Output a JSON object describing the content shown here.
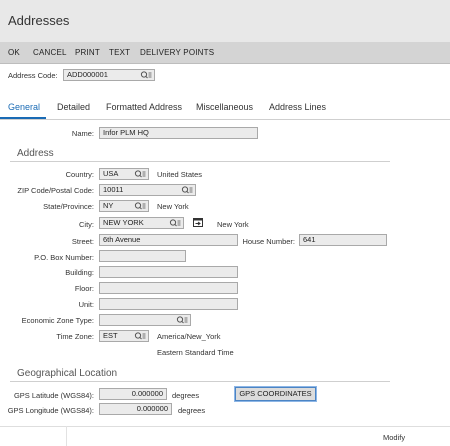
{
  "window": {
    "title": "Addresses"
  },
  "toolbar": {
    "ok": "OK",
    "cancel": "CANCEL",
    "print": "PRINT",
    "text": "TEXT",
    "delivery_points": "DELIVERY POINTS"
  },
  "address_code": {
    "label": "Address Code:",
    "value": "ADD000001"
  },
  "tabs": [
    {
      "label": "General",
      "active": true
    },
    {
      "label": "Detailed"
    },
    {
      "label": "Formatted Address"
    },
    {
      "label": "Miscellaneous"
    },
    {
      "label": "Address Lines"
    }
  ],
  "name": {
    "label": "Name:",
    "value": "Infor PLM HQ"
  },
  "address_section": {
    "title": "Address"
  },
  "country": {
    "label": "Country:",
    "value": "USA",
    "description": "United States"
  },
  "zip": {
    "label": "ZIP Code/Postal Code:",
    "value": "10011"
  },
  "state": {
    "label": "State/Province:",
    "value": "NY",
    "description": "New York"
  },
  "city": {
    "label": "City:",
    "value": "NEW YORK",
    "description": "New York"
  },
  "street": {
    "label": "Street:",
    "value": "6th Avenue"
  },
  "house_number": {
    "label": "House Number:",
    "value": "641"
  },
  "po_box": {
    "label": "P.O. Box Number:",
    "value": ""
  },
  "building": {
    "label": "Building:",
    "value": ""
  },
  "floor": {
    "label": "Floor:",
    "value": ""
  },
  "unit": {
    "label": "Unit:",
    "value": ""
  },
  "economic_zone": {
    "label": "Economic Zone Type:",
    "value": ""
  },
  "time_zone": {
    "label": "Time Zone:",
    "value": "EST",
    "description": "America/New_York",
    "long_name": "Eastern Standard Time"
  },
  "geo_section": {
    "title": "Geographical Location"
  },
  "gps_latitude": {
    "label": "GPS Latitude (WGS84):",
    "value": "0.000000",
    "unit": "degrees"
  },
  "gps_longitude": {
    "label": "GPS Longitude (WGS84):",
    "value": "0.000000",
    "unit": "degrees"
  },
  "gps_button": {
    "label": "GPS COORDINATES"
  },
  "footer": {
    "modify": "Modify"
  },
  "colors": {
    "accent": "#1a6bb5",
    "toolbar_bg": "#d4d4d4",
    "field_bg": "#ebebeb"
  }
}
